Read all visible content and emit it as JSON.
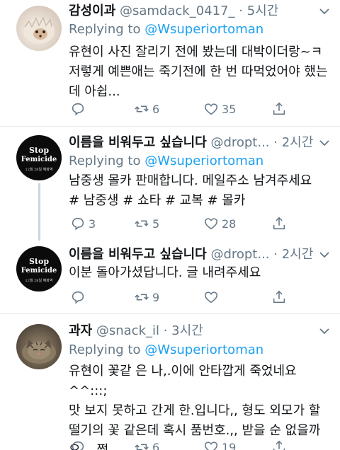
{
  "tweets": [
    {
      "name": "감성이과",
      "handle": "@samdack_0417_",
      "time": "· 5시간",
      "reply_prefix": "Replying to",
      "reply_to": "@Wsuperiortoman",
      "text_lines": [
        "유현이 사진 잘리기 전에 봤는데 대박이더랑~ㅋ",
        "저렇게 예쁜애는 죽기전에 한 번 따먹었어야 했는",
        "데 아쉽..."
      ],
      "replies": "",
      "retweets": "6",
      "likes": "35",
      "avatar": "hedgehog"
    },
    {
      "name": "이름을 비워두고 싶습니다",
      "handle": "@dropt...",
      "time": "· 2시간",
      "reply_prefix": "Replying to",
      "reply_to": "@Wsuperiortoman",
      "text_lines": [
        "남중생 몰카 판매합니다. 메일주소 남겨주세요",
        "# 남중생 # 쇼타 # 교복 # 몰카"
      ],
      "replies": "3",
      "retweets": "5",
      "likes": "28",
      "avatar": "stop-femicide"
    },
    {
      "name": "이름을 비워두고 싶습니다",
      "handle": "@dropt...",
      "time": "· 2시간",
      "text_lines": [
        "이분 돌아가셨답니다. 글 내려주세요"
      ],
      "replies": "",
      "retweets": "9",
      "likes": "",
      "avatar": "stop-femicide"
    },
    {
      "name": "과자",
      "handle": "@snack_il",
      "time": "· 3시간",
      "reply_prefix": "Replying to",
      "reply_to": "@Wsuperiortoman",
      "text_lines": [
        "유현이 꽃같 은 나,.이에 안타깝게 죽었네요 ^^:::;",
        "맛 보지 못하고 간게 한.입니다,, 형도 외모가 할",
        "떨기의 꽃 같은데 혹시 품번호.,, 받을 순 없을까",
        "요....쩝."
      ],
      "replies": "",
      "retweets": "6",
      "likes": "19",
      "avatar": "cat"
    }
  ],
  "stop_femicide": {
    "line1": "Stop",
    "line2": "Femicide",
    "line3": "12월 28일 혜화역"
  },
  "colors": {
    "link": "#1da1f2",
    "meta": "#657786",
    "text": "#14171a",
    "divider": "#e1e8ed",
    "thread": "#ccd6dd"
  },
  "icons": {
    "reply": "comment-icon",
    "retweet": "retweet-icon",
    "like": "heart-icon",
    "share": "share-icon",
    "more": "chevron-down-icon"
  }
}
